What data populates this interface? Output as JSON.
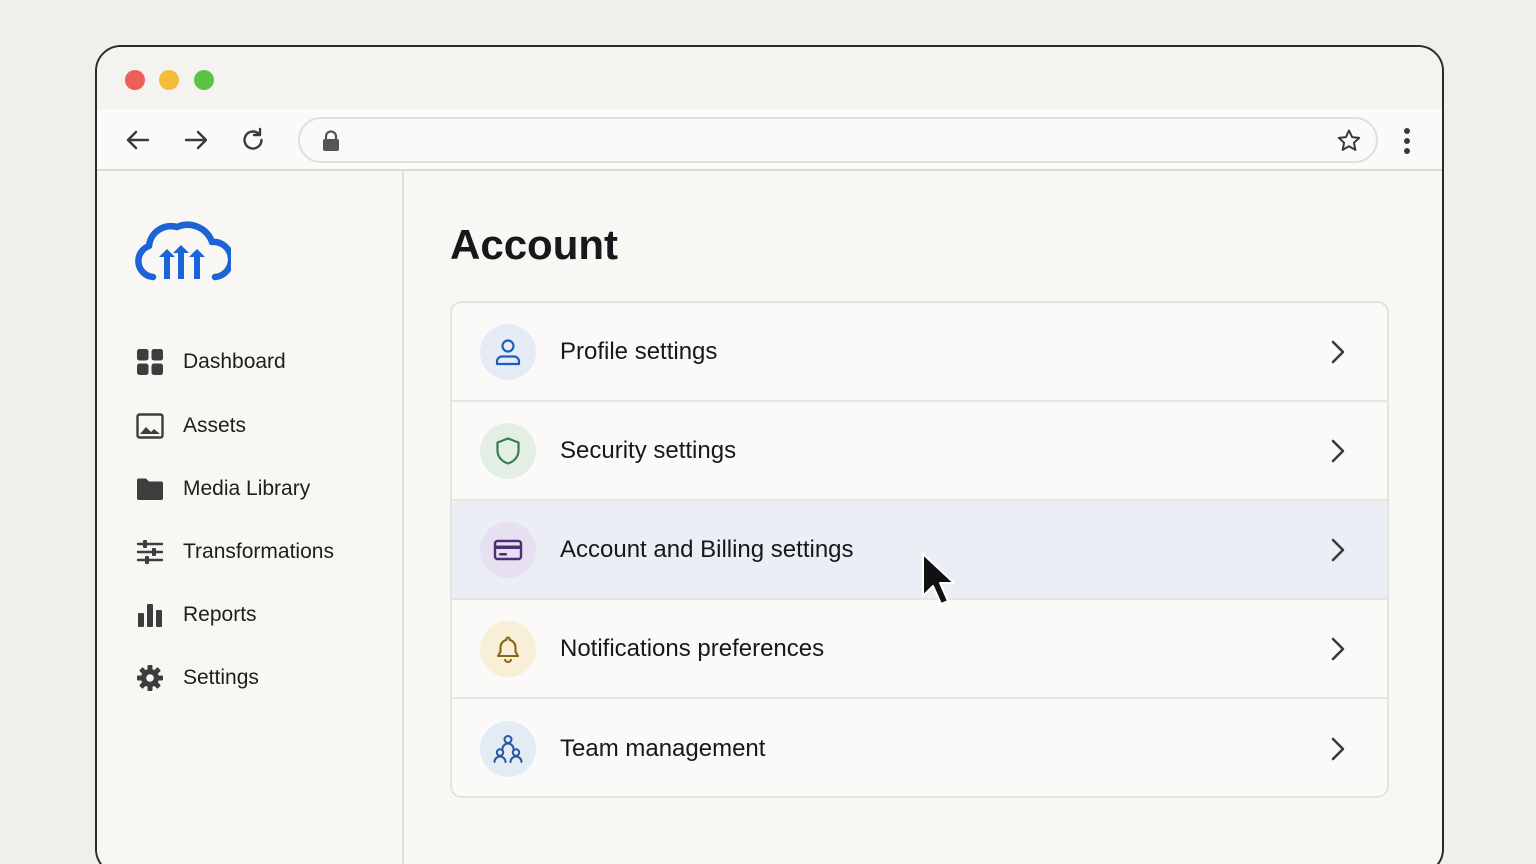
{
  "browser": {
    "url": ""
  },
  "sidebar": {
    "items": [
      {
        "label": "Dashboard",
        "icon": "dashboard-grid-icon"
      },
      {
        "label": "Assets",
        "icon": "image-icon"
      },
      {
        "label": "Media Library",
        "icon": "folder-icon"
      },
      {
        "label": "Transformations",
        "icon": "sliders-icon"
      },
      {
        "label": "Reports",
        "icon": "bar-chart-icon"
      },
      {
        "label": "Settings",
        "icon": "gear-icon"
      }
    ]
  },
  "main": {
    "title": "Account",
    "rows": [
      {
        "label": "Profile settings",
        "icon": "user-icon",
        "icon_bg": "#e6ecf5",
        "icon_color": "#1f5fb8"
      },
      {
        "label": "Security settings",
        "icon": "shield-icon",
        "icon_bg": "#e3efe5",
        "icon_color": "#3c7a4c"
      },
      {
        "label": "Account and Billing settings",
        "icon": "credit-card-icon",
        "icon_bg": "#e7e0f0",
        "icon_color": "#5b3a84",
        "highlighted": true
      },
      {
        "label": "Notifications preferences",
        "icon": "bell-icon",
        "icon_bg": "#f8efd7",
        "icon_color": "#a2761e"
      },
      {
        "label": "Team management",
        "icon": "team-icon",
        "icon_bg": "#e3ebf5",
        "icon_color": "#2458a0"
      }
    ]
  },
  "colors": {
    "brand": "#1d63d8",
    "highlight_row": "#ebeef5"
  }
}
